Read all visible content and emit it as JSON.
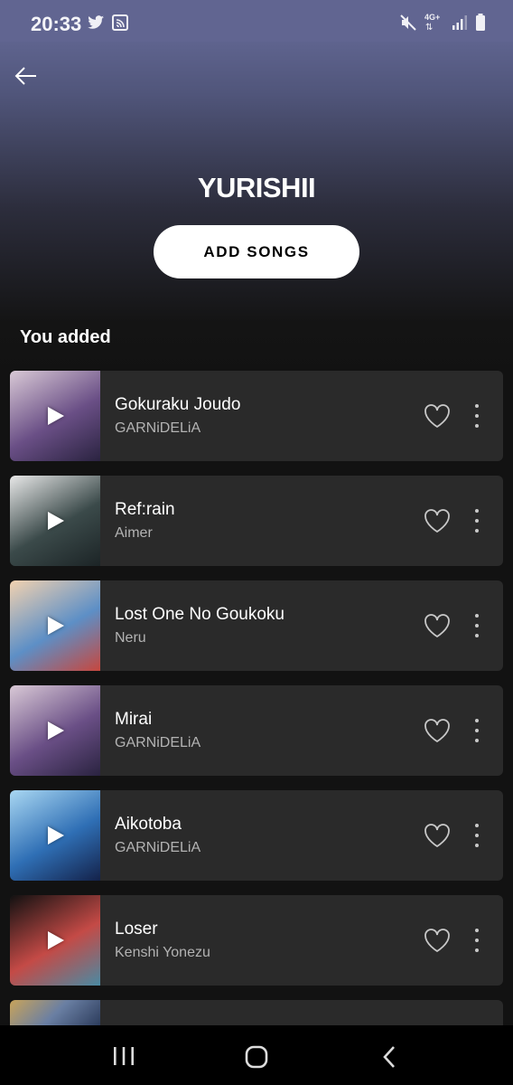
{
  "status_bar": {
    "time": "20:33",
    "network": "4G+",
    "icons": [
      "twitter-icon",
      "cast-icon",
      "mute-icon",
      "network-icon",
      "signal-icon",
      "battery-icon"
    ]
  },
  "header": {
    "back_icon": "arrow-left-icon",
    "title": "YURISHII",
    "add_songs_label": "ADD SONGS"
  },
  "section": {
    "heading": "You added"
  },
  "tracks": [
    {
      "title": "Gokuraku Joudo",
      "artist": "GARNiDELiA",
      "art_colors": [
        "#d9c9d6",
        "#6a4f86",
        "#2a2340"
      ]
    },
    {
      "title": "Ref:rain",
      "artist": "Aimer",
      "art_colors": [
        "#e8e8e8",
        "#3b4a4a",
        "#1c2426"
      ]
    },
    {
      "title": "Lost One No Goukoku",
      "artist": "Neru",
      "art_colors": [
        "#f2d2b0",
        "#5d8fc6",
        "#c7473e"
      ]
    },
    {
      "title": "Mirai",
      "artist": "GARNiDELiA",
      "art_colors": [
        "#d9c9d6",
        "#6a4f86",
        "#2a2340"
      ]
    },
    {
      "title": "Aikotoba",
      "artist": "GARNiDELiA",
      "art_colors": [
        "#a9d7f2",
        "#2f6fb5",
        "#14224a"
      ]
    },
    {
      "title": "Loser",
      "artist": "Kenshi Yonezu",
      "art_colors": [
        "#111111",
        "#c44a46",
        "#4a8aa3"
      ]
    }
  ],
  "colors": {
    "background": "#121212",
    "header_gradient_top": "#6a6f9e",
    "row_background": "#2a2a2a",
    "secondary_text": "#b3b3b3"
  },
  "nav": {
    "icons": [
      "recent-apps-icon",
      "home-icon",
      "back-icon"
    ]
  }
}
